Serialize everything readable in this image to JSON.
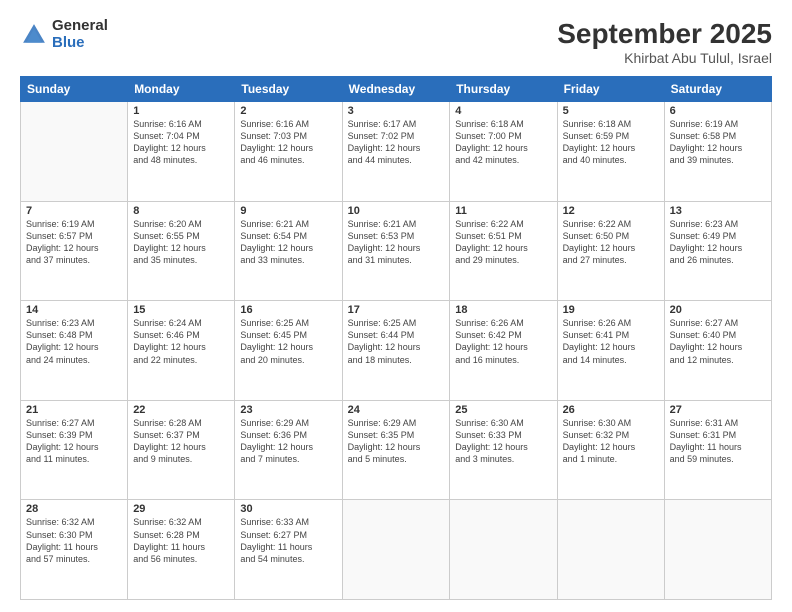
{
  "header": {
    "logo_general": "General",
    "logo_blue": "Blue",
    "month_title": "September 2025",
    "location": "Khirbat Abu Tulul, Israel"
  },
  "weekdays": [
    "Sunday",
    "Monday",
    "Tuesday",
    "Wednesday",
    "Thursday",
    "Friday",
    "Saturday"
  ],
  "weeks": [
    [
      {
        "day": "",
        "info": ""
      },
      {
        "day": "1",
        "info": "Sunrise: 6:16 AM\nSunset: 7:04 PM\nDaylight: 12 hours\nand 48 minutes."
      },
      {
        "day": "2",
        "info": "Sunrise: 6:16 AM\nSunset: 7:03 PM\nDaylight: 12 hours\nand 46 minutes."
      },
      {
        "day": "3",
        "info": "Sunrise: 6:17 AM\nSunset: 7:02 PM\nDaylight: 12 hours\nand 44 minutes."
      },
      {
        "day": "4",
        "info": "Sunrise: 6:18 AM\nSunset: 7:00 PM\nDaylight: 12 hours\nand 42 minutes."
      },
      {
        "day": "5",
        "info": "Sunrise: 6:18 AM\nSunset: 6:59 PM\nDaylight: 12 hours\nand 40 minutes."
      },
      {
        "day": "6",
        "info": "Sunrise: 6:19 AM\nSunset: 6:58 PM\nDaylight: 12 hours\nand 39 minutes."
      }
    ],
    [
      {
        "day": "7",
        "info": "Sunrise: 6:19 AM\nSunset: 6:57 PM\nDaylight: 12 hours\nand 37 minutes."
      },
      {
        "day": "8",
        "info": "Sunrise: 6:20 AM\nSunset: 6:55 PM\nDaylight: 12 hours\nand 35 minutes."
      },
      {
        "day": "9",
        "info": "Sunrise: 6:21 AM\nSunset: 6:54 PM\nDaylight: 12 hours\nand 33 minutes."
      },
      {
        "day": "10",
        "info": "Sunrise: 6:21 AM\nSunset: 6:53 PM\nDaylight: 12 hours\nand 31 minutes."
      },
      {
        "day": "11",
        "info": "Sunrise: 6:22 AM\nSunset: 6:51 PM\nDaylight: 12 hours\nand 29 minutes."
      },
      {
        "day": "12",
        "info": "Sunrise: 6:22 AM\nSunset: 6:50 PM\nDaylight: 12 hours\nand 27 minutes."
      },
      {
        "day": "13",
        "info": "Sunrise: 6:23 AM\nSunset: 6:49 PM\nDaylight: 12 hours\nand 26 minutes."
      }
    ],
    [
      {
        "day": "14",
        "info": "Sunrise: 6:23 AM\nSunset: 6:48 PM\nDaylight: 12 hours\nand 24 minutes."
      },
      {
        "day": "15",
        "info": "Sunrise: 6:24 AM\nSunset: 6:46 PM\nDaylight: 12 hours\nand 22 minutes."
      },
      {
        "day": "16",
        "info": "Sunrise: 6:25 AM\nSunset: 6:45 PM\nDaylight: 12 hours\nand 20 minutes."
      },
      {
        "day": "17",
        "info": "Sunrise: 6:25 AM\nSunset: 6:44 PM\nDaylight: 12 hours\nand 18 minutes."
      },
      {
        "day": "18",
        "info": "Sunrise: 6:26 AM\nSunset: 6:42 PM\nDaylight: 12 hours\nand 16 minutes."
      },
      {
        "day": "19",
        "info": "Sunrise: 6:26 AM\nSunset: 6:41 PM\nDaylight: 12 hours\nand 14 minutes."
      },
      {
        "day": "20",
        "info": "Sunrise: 6:27 AM\nSunset: 6:40 PM\nDaylight: 12 hours\nand 12 minutes."
      }
    ],
    [
      {
        "day": "21",
        "info": "Sunrise: 6:27 AM\nSunset: 6:39 PM\nDaylight: 12 hours\nand 11 minutes."
      },
      {
        "day": "22",
        "info": "Sunrise: 6:28 AM\nSunset: 6:37 PM\nDaylight: 12 hours\nand 9 minutes."
      },
      {
        "day": "23",
        "info": "Sunrise: 6:29 AM\nSunset: 6:36 PM\nDaylight: 12 hours\nand 7 minutes."
      },
      {
        "day": "24",
        "info": "Sunrise: 6:29 AM\nSunset: 6:35 PM\nDaylight: 12 hours\nand 5 minutes."
      },
      {
        "day": "25",
        "info": "Sunrise: 6:30 AM\nSunset: 6:33 PM\nDaylight: 12 hours\nand 3 minutes."
      },
      {
        "day": "26",
        "info": "Sunrise: 6:30 AM\nSunset: 6:32 PM\nDaylight: 12 hours\nand 1 minute."
      },
      {
        "day": "27",
        "info": "Sunrise: 6:31 AM\nSunset: 6:31 PM\nDaylight: 11 hours\nand 59 minutes."
      }
    ],
    [
      {
        "day": "28",
        "info": "Sunrise: 6:32 AM\nSunset: 6:30 PM\nDaylight: 11 hours\nand 57 minutes."
      },
      {
        "day": "29",
        "info": "Sunrise: 6:32 AM\nSunset: 6:28 PM\nDaylight: 11 hours\nand 56 minutes."
      },
      {
        "day": "30",
        "info": "Sunrise: 6:33 AM\nSunset: 6:27 PM\nDaylight: 11 hours\nand 54 minutes."
      },
      {
        "day": "",
        "info": ""
      },
      {
        "day": "",
        "info": ""
      },
      {
        "day": "",
        "info": ""
      },
      {
        "day": "",
        "info": ""
      }
    ]
  ]
}
